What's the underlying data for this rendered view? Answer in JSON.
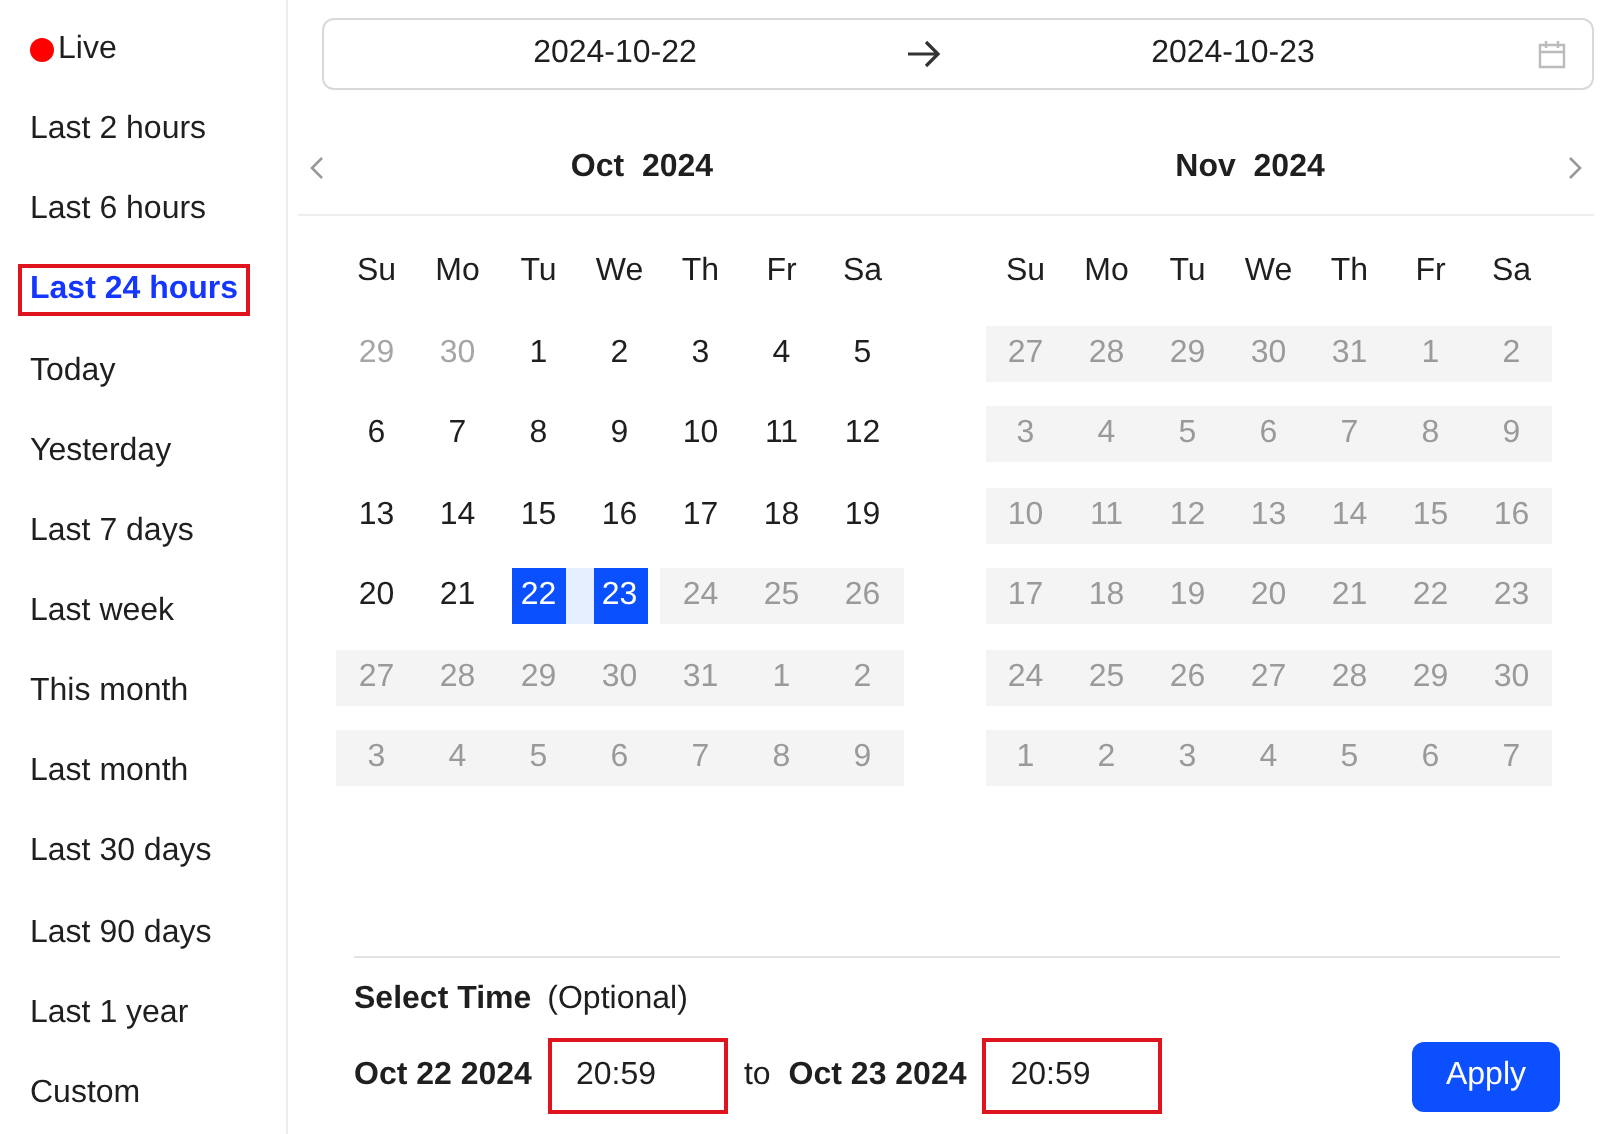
{
  "sidebar": {
    "items": [
      {
        "label": "Live",
        "kind": "live",
        "selected": false
      },
      {
        "label": "Last 2 hours",
        "kind": "preset",
        "selected": false
      },
      {
        "label": "Last 6 hours",
        "kind": "preset",
        "selected": false
      },
      {
        "label": "Last 24 hours",
        "kind": "preset",
        "selected": true
      },
      {
        "label": "Today",
        "kind": "preset",
        "selected": false
      },
      {
        "label": "Yesterday",
        "kind": "preset",
        "selected": false
      },
      {
        "label": "Last 7 days",
        "kind": "preset",
        "selected": false
      },
      {
        "label": "Last week",
        "kind": "preset",
        "selected": false
      },
      {
        "label": "This month",
        "kind": "preset",
        "selected": false
      },
      {
        "label": "Last month",
        "kind": "preset",
        "selected": false
      },
      {
        "label": "Last 30 days",
        "kind": "preset",
        "selected": false
      },
      {
        "label": "Last 90 days",
        "kind": "preset",
        "selected": false
      },
      {
        "label": "Last 1 year",
        "kind": "preset",
        "selected": false
      },
      {
        "label": "Custom",
        "kind": "preset",
        "selected": false
      }
    ]
  },
  "range_field": {
    "start": "2024-10-22",
    "end": "2024-10-23"
  },
  "calendars": [
    {
      "month": "Oct",
      "year": "2024",
      "weekdays": [
        "Su",
        "Mo",
        "Tu",
        "We",
        "Th",
        "Fr",
        "Sa"
      ],
      "weeks": [
        [
          {
            "label": "29",
            "kind": "outside"
          },
          {
            "label": "30",
            "kind": "outside"
          },
          {
            "label": "1",
            "kind": "day"
          },
          {
            "label": "2",
            "kind": "day"
          },
          {
            "label": "3",
            "kind": "day"
          },
          {
            "label": "4",
            "kind": "day"
          },
          {
            "label": "5",
            "kind": "day"
          }
        ],
        [
          {
            "label": "6",
            "kind": "day"
          },
          {
            "label": "7",
            "kind": "day"
          },
          {
            "label": "8",
            "kind": "day"
          },
          {
            "label": "9",
            "kind": "day"
          },
          {
            "label": "10",
            "kind": "day"
          },
          {
            "label": "11",
            "kind": "day"
          },
          {
            "label": "12",
            "kind": "day"
          }
        ],
        [
          {
            "label": "13",
            "kind": "day"
          },
          {
            "label": "14",
            "kind": "day"
          },
          {
            "label": "15",
            "kind": "day"
          },
          {
            "label": "16",
            "kind": "day"
          },
          {
            "label": "17",
            "kind": "day"
          },
          {
            "label": "18",
            "kind": "day"
          },
          {
            "label": "19",
            "kind": "day"
          }
        ],
        [
          {
            "label": "20",
            "kind": "day"
          },
          {
            "label": "21",
            "kind": "day"
          },
          {
            "label": "22",
            "kind": "selected"
          },
          {
            "label": "23",
            "kind": "selected"
          },
          {
            "label": "24",
            "kind": "disabled"
          },
          {
            "label": "25",
            "kind": "disabled"
          },
          {
            "label": "26",
            "kind": "disabled"
          }
        ],
        [
          {
            "label": "27",
            "kind": "disabled"
          },
          {
            "label": "28",
            "kind": "disabled"
          },
          {
            "label": "29",
            "kind": "disabled"
          },
          {
            "label": "30",
            "kind": "disabled"
          },
          {
            "label": "31",
            "kind": "disabled"
          },
          {
            "label": "1",
            "kind": "disabled"
          },
          {
            "label": "2",
            "kind": "disabled"
          }
        ],
        [
          {
            "label": "3",
            "kind": "disabled"
          },
          {
            "label": "4",
            "kind": "disabled"
          },
          {
            "label": "5",
            "kind": "disabled"
          },
          {
            "label": "6",
            "kind": "disabled"
          },
          {
            "label": "7",
            "kind": "disabled"
          },
          {
            "label": "8",
            "kind": "disabled"
          },
          {
            "label": "9",
            "kind": "disabled"
          }
        ]
      ]
    },
    {
      "month": "Nov",
      "year": "2024",
      "weekdays": [
        "Su",
        "Mo",
        "Tu",
        "We",
        "Th",
        "Fr",
        "Sa"
      ],
      "weeks": [
        [
          {
            "label": "27",
            "kind": "disabled"
          },
          {
            "label": "28",
            "kind": "disabled"
          },
          {
            "label": "29",
            "kind": "disabled"
          },
          {
            "label": "30",
            "kind": "disabled"
          },
          {
            "label": "31",
            "kind": "disabled"
          },
          {
            "label": "1",
            "kind": "disabled"
          },
          {
            "label": "2",
            "kind": "disabled"
          }
        ],
        [
          {
            "label": "3",
            "kind": "disabled"
          },
          {
            "label": "4",
            "kind": "disabled"
          },
          {
            "label": "5",
            "kind": "disabled"
          },
          {
            "label": "6",
            "kind": "disabled"
          },
          {
            "label": "7",
            "kind": "disabled"
          },
          {
            "label": "8",
            "kind": "disabled"
          },
          {
            "label": "9",
            "kind": "disabled"
          }
        ],
        [
          {
            "label": "10",
            "kind": "disabled"
          },
          {
            "label": "11",
            "kind": "disabled"
          },
          {
            "label": "12",
            "kind": "disabled"
          },
          {
            "label": "13",
            "kind": "disabled"
          },
          {
            "label": "14",
            "kind": "disabled"
          },
          {
            "label": "15",
            "kind": "disabled"
          },
          {
            "label": "16",
            "kind": "disabled"
          }
        ],
        [
          {
            "label": "17",
            "kind": "disabled"
          },
          {
            "label": "18",
            "kind": "disabled"
          },
          {
            "label": "19",
            "kind": "disabled"
          },
          {
            "label": "20",
            "kind": "disabled"
          },
          {
            "label": "21",
            "kind": "disabled"
          },
          {
            "label": "22",
            "kind": "disabled"
          },
          {
            "label": "23",
            "kind": "disabled"
          }
        ],
        [
          {
            "label": "24",
            "kind": "disabled"
          },
          {
            "label": "25",
            "kind": "disabled"
          },
          {
            "label": "26",
            "kind": "disabled"
          },
          {
            "label": "27",
            "kind": "disabled"
          },
          {
            "label": "28",
            "kind": "disabled"
          },
          {
            "label": "29",
            "kind": "disabled"
          },
          {
            "label": "30",
            "kind": "disabled"
          }
        ],
        [
          {
            "label": "1",
            "kind": "disabled"
          },
          {
            "label": "2",
            "kind": "disabled"
          },
          {
            "label": "3",
            "kind": "disabled"
          },
          {
            "label": "4",
            "kind": "disabled"
          },
          {
            "label": "5",
            "kind": "disabled"
          },
          {
            "label": "6",
            "kind": "disabled"
          },
          {
            "label": "7",
            "kind": "disabled"
          }
        ]
      ]
    }
  ],
  "time": {
    "title": "Select Time",
    "note": "(Optional)",
    "from_date": "Oct 22 2024",
    "from_time": {
      "value": "20:59",
      "highlighted": true
    },
    "separator": "to",
    "to_date": "Oct 23 2024",
    "to_time": {
      "value": "20:59",
      "highlighted": true
    }
  },
  "apply_button": "Apply"
}
